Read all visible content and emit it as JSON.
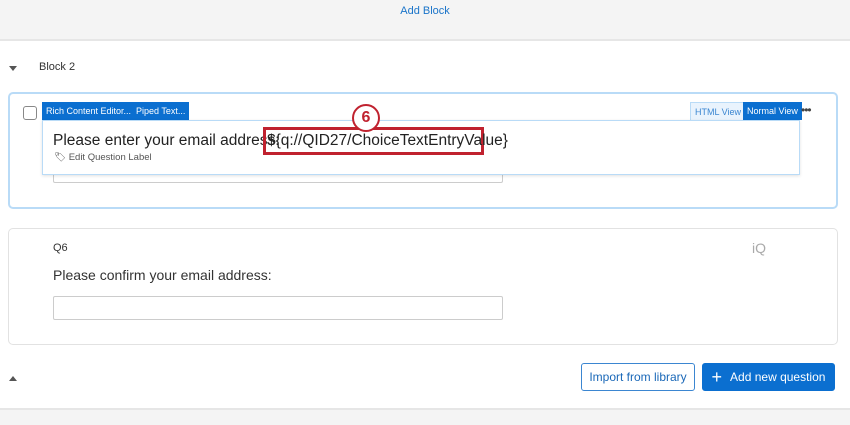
{
  "top": {
    "add_block": "Add Block"
  },
  "block": {
    "title": "Block 2"
  },
  "q5": {
    "tabs_left": [
      "Rich Content Editor...",
      "Piped Text..."
    ],
    "tabs_right": [
      "HTML View",
      "Normal View"
    ],
    "more": "•••",
    "prompt": "Please enter your email address:",
    "piped_text": "${q://QID27/ChoiceTextEntryValue}",
    "annotation": "6",
    "edit_label": "Edit Question Label"
  },
  "q6": {
    "label": "Q6",
    "logo": "iQ",
    "prompt": "Please confirm your email address:"
  },
  "actions": {
    "import": "Import from library",
    "add_icon": "+",
    "add": "Add new question"
  },
  "colors": {
    "accent": "#0b6fd0",
    "annotation": "#c0222f"
  }
}
